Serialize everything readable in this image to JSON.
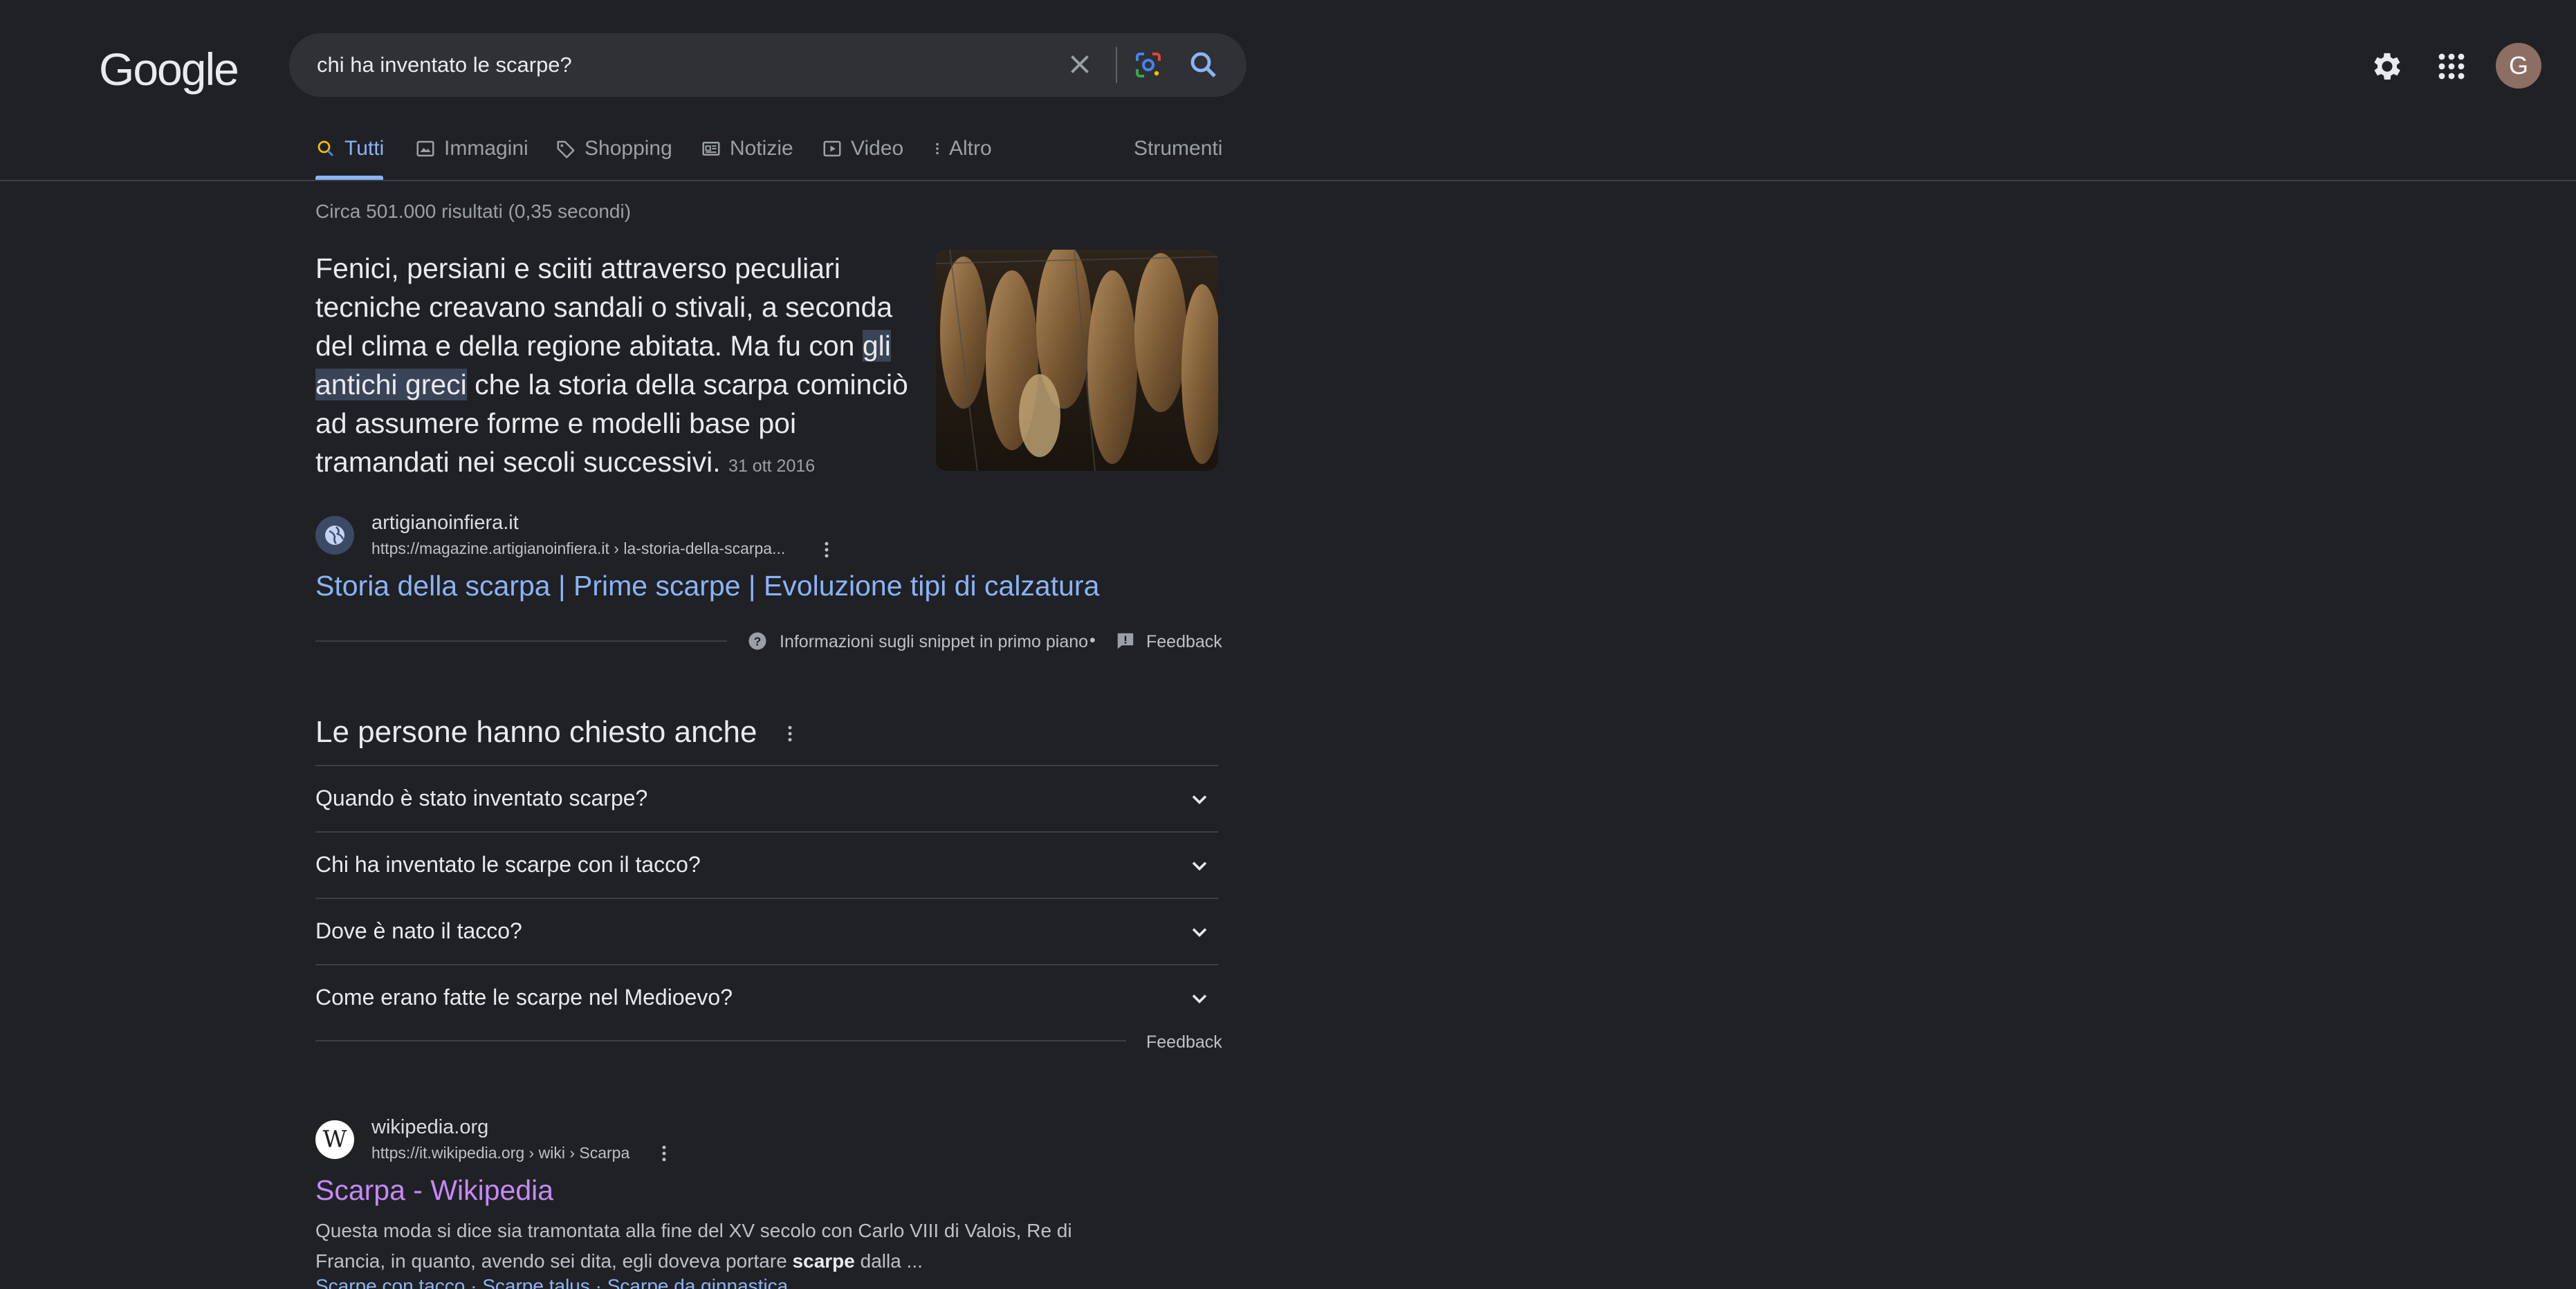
{
  "header": {
    "logo": "Google",
    "query": "chi ha inventato le scarpe?",
    "avatar_letter": "G"
  },
  "tabs": [
    {
      "label": "Tutti",
      "icon": "search-icon"
    },
    {
      "label": "Immagini",
      "icon": "image-icon"
    },
    {
      "label": "Shopping",
      "icon": "tag-icon"
    },
    {
      "label": "Notizie",
      "icon": "news-icon"
    },
    {
      "label": "Video",
      "icon": "play-icon"
    },
    {
      "label": "Altro",
      "icon": "more-vert-icon"
    }
  ],
  "tools_label": "Strumenti",
  "result_stats": "Circa 501.000 risultati (0,35 secondi)",
  "featured_snippet": {
    "text_before": "Fenici, persiani e sciiti attraverso peculiari tecniche creavano sandali o stivali, a seconda del clima e della regione abitata. Ma fu con ",
    "highlight": "gli antichi greci",
    "text_after": " che la storia della scarpa cominciò ad assumere forme e modelli base poi tramandati nei secoli successivi.",
    "date": "31 ott 2016",
    "site": "artigianoinfiera.it",
    "url": "https://magazine.artigianoinfiera.it › la-storia-della-scarpa...",
    "title": "Storia della scarpa | Prime scarpe | Evoluzione tipi di calzatura",
    "about_label": "Informazioni sugli snippet in primo piano",
    "separator": "•",
    "feedback_label": "Feedback"
  },
  "people_also_ask": {
    "title": "Le persone hanno chiesto anche",
    "questions": [
      "Quando è stato inventato scarpe?",
      "Chi ha inventato le scarpe con il tacco?",
      "Dove è nato il tacco?",
      "Come erano fatte le scarpe nel Medioevo?"
    ],
    "feedback_label": "Feedback"
  },
  "wiki_result": {
    "favicon_letter": "W",
    "site": "wikipedia.org",
    "url": "https://it.wikipedia.org › wiki › Scarpa",
    "title": "Scarpa - Wikipedia",
    "snippet_before": "Questa moda si dice sia tramontata alla fine del XV secolo con Carlo VIII di Valois, Re di Francia, in quanto, avendo sei dita, egli doveva portare ",
    "snippet_bold": "scarpe",
    "snippet_after": " dalla ...",
    "sitelinks": "Scarpe con tacco · Scarpe talus · Scarpe da ginnastica"
  },
  "colors": {
    "background": "#202124",
    "link": "#8ab4f8",
    "visited_link": "#c58af9",
    "text": "#e8eaed"
  }
}
